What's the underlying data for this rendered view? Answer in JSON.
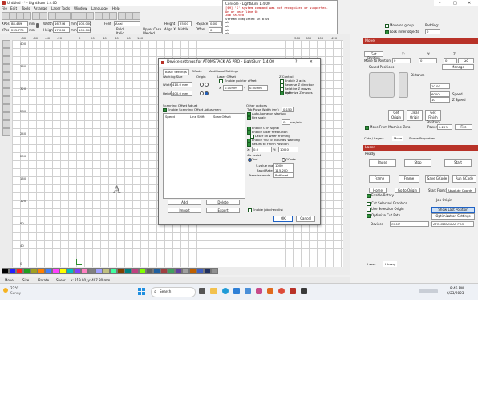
{
  "window": {
    "title": "Untitled - * - LightBurn 1.4.00"
  },
  "menu": [
    "File",
    "Edit",
    "Tools",
    "Arrange",
    "Laser Tools",
    "Window",
    "Language",
    "Help"
  ],
  "coords": {
    "xpos_label": "XPos",
    "xpos_val": "88.489",
    "ypos_label": "YPos",
    "ypos_val": "235.775",
    "unit": "mm",
    "width_label": "Width",
    "width_val": "16.746",
    "height_label": "Height",
    "height_val": "17.006",
    "pct": "100.000",
    "pct_sign": "%"
  },
  "font_bar": {
    "font_label": "Font",
    "font_val": "Arial",
    "height_label": "Height",
    "height_val": "25.00",
    "hspace_label": "HSpace",
    "hspace_val": "0.00",
    "bold": "Bold",
    "italic": "Italic",
    "upper": "Upper Case",
    "welded": "Welded",
    "distort": "Distort",
    "align_x": "Align X",
    "middle": "Middle",
    "normal": "Normal",
    "offset_label": "Offset",
    "offset_val": "0"
  },
  "console": {
    "title": "Console - LightBurn 1.4.00",
    "lines": [
      "[$H] 'S' system command was not recognized or supported.",
      "On or near line 0:",
      "Job halted",
      "Stream completed in 0:00",
      "ok",
      "ok",
      "ok",
      "ok",
      "ok",
      "ok",
      "ok",
      "ok",
      "[GS] 1.1f ['$' for help]",
      "[GS] 1.1f ['$' for help]",
      "ok"
    ]
  },
  "right_top": {
    "move_on_group": "Move on group",
    "lock_inner": "Lock inner objects",
    "padding_label": "Padding:",
    "padding_val": "0"
  },
  "ruler_top": [
    "-80",
    "-60",
    "-40",
    "-20",
    "0",
    "20",
    "40",
    "60",
    "80",
    "100",
    "120",
    "140",
    "160",
    "180",
    "200",
    "220",
    "240",
    "260",
    "280",
    "300",
    "320",
    "340",
    "360",
    "380",
    "400",
    "420"
  ],
  "ruler_left": [
    "400",
    "380",
    "360",
    "340",
    "320",
    "300",
    "280",
    "260",
    "240",
    "220",
    "200",
    "180",
    "160",
    "140",
    "120",
    "100",
    "80",
    "60",
    "40",
    "20",
    "0"
  ],
  "canvas": {
    "label": "A"
  },
  "dialog": {
    "title": "Device settings for ATOMSTACK A5 PRO - LightBurn 1.4.00",
    "help": "?",
    "close": "✕",
    "tabs": [
      "Basic Settings",
      "GCode",
      "Additional Settings"
    ],
    "working_size": "Working Size",
    "origin": "Origin",
    "width_label": "Width",
    "width_val": "410.0 mm",
    "height_label": "Height",
    "height_val": "400.0 mm",
    "laser_offset": "Laser Offset",
    "enable_pointer": "Enable pointer offset",
    "x_label": "X",
    "x_val": "0.00mm",
    "y_label": "Y",
    "y_val": "0.00mm",
    "z_control": "Z Control",
    "enable_z": "Enable Z axis",
    "reverse_z": "Reverse Z direction",
    "relative_z": "Relative Z moves only",
    "optimize_z": "Optimize Z moves",
    "scan_offset": "Scanning Offset Adjust",
    "enable_scan": "Enable Scanning Offset Adjustment",
    "cols": [
      "Speed",
      "Line Shift",
      "Scan Offset"
    ],
    "add": "Add",
    "delete": "Delete",
    "import": "Import",
    "export": "Export",
    "other": "Other options",
    "tab_pulse": "Tab Pulse Width (ms)",
    "tab_pulse_val": "0.150",
    "auto_home": "Auto-home on startup",
    "fire_scale": "Fire scale",
    "fire_val": "0",
    "fire_unit": "mm/min",
    "enable_gtr": "Enable GTR signal",
    "enable_fire": "Enable laser fire button",
    "laser_refresh": "Laser on when framing",
    "enable_oob": "Enable 'Out of Bounds' warning",
    "return_finish": "Return to Finish Position",
    "fx_label": "X:",
    "fx_val": "0.0",
    "fy_label": "Y:",
    "fy_val": "100.0",
    "air_assist": "Air Assist",
    "tool": "Tool",
    "gcode": "GCode",
    "s_value": "S-value max",
    "s_val": "1000",
    "baud": "Baud Rate",
    "baud_val": "115,200",
    "transfer": "Transfer mode",
    "transfer_val": "Buffered",
    "enable_job": "Enable job checklist",
    "ok": "OK",
    "cancel": "Cancel"
  },
  "move_panel": {
    "head": "Move",
    "get_position": "Get Position",
    "x_lbl": "X:",
    "x_val": "0",
    "y_lbl": "Y:",
    "y_val": "0",
    "z_lbl": "Z:",
    "z_val": "0",
    "move_to": "Move to Position",
    "go": "Go",
    "saved": "Saved Positions",
    "manage": "Manage",
    "distance": "Distance",
    "dist_val": "10.00",
    "speed_lbl": "Speed",
    "speed_val": "6000",
    "zspeed_lbl": "Z Speed",
    "zspeed_val": "10",
    "get_origin": "Get Origin",
    "clear_origin": "Clear Origin",
    "get_finish": "Get Finish Position",
    "move_from": "Move From Machine Zero",
    "power_lbl": "Power",
    "power_val": "0.25%",
    "fire": "Fire"
  },
  "tabs_mid": [
    "Cuts / Layers",
    "Move",
    "Shape Properties"
  ],
  "laser_panel": {
    "head": "Laser",
    "status": "Ready",
    "pause": "Pause",
    "stop": "Stop",
    "start": "Start",
    "frame": "Frame",
    "frame2": "Frame",
    "save_gcode": "Save GCode",
    "run_gcode": "Run GCode",
    "home": "Home",
    "go_origin": "Go to Origin",
    "start_from": "Start From:",
    "start_val": "Absolute Coords",
    "job_origin": "Job Origin",
    "enable_rotary": "Enable Rotary",
    "cut_selected": "Cut Selected Graphics",
    "use_sel_origin": "Use Selection Origin",
    "show_last": "Show Last Position",
    "optimize": "Optimize Cut Path",
    "opt_settings": "Optimization Settings",
    "devices": "Devices",
    "port": "COM7",
    "device_val": "ATOMSTACK A5 PRO"
  },
  "bottom_tabs": [
    "Laser",
    "Library"
  ],
  "status_bar": {
    "move": "Move",
    "size": "Size",
    "rotate": "Rotate",
    "shear": "Shear",
    "coords": "x: 219.00, y: 407.80 mm"
  },
  "taskbar": {
    "temp": "22°C",
    "weather": "Sunny",
    "search": "Search",
    "time": "8:46 PM",
    "date": "6/23/2023"
  },
  "swatches": [
    "#000000",
    "#2020ff",
    "#ff2020",
    "#20a020",
    "#a0a020",
    "#ff8000",
    "#4080ff",
    "#ff40ff",
    "#ffff00",
    "#00c0c0",
    "#8040ff",
    "#ff80c0",
    "#808080",
    "#a0a0ff",
    "#c0c080",
    "#40ffa0",
    "#804000",
    "#008080",
    "#c04080",
    "#80ff00",
    "#606060",
    "#2060a0",
    "#a04040",
    "#40a060",
    "#6040a0",
    "#a0a0a0",
    "#c06000",
    "#4060c0",
    "#203060",
    "#909090"
  ]
}
